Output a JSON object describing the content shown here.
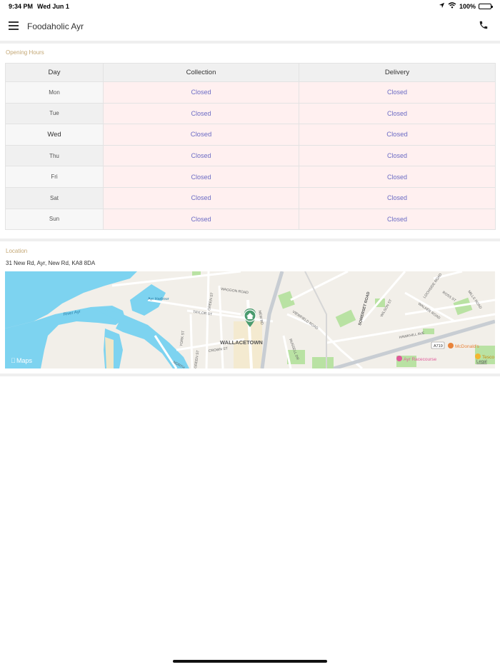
{
  "status_bar": {
    "time": "9:34 PM",
    "date": "Wed Jun 1",
    "battery": "100%",
    "battery_level": 1.0
  },
  "header": {
    "title": "Foodaholic Ayr"
  },
  "opening_hours": {
    "label": "Opening Hours",
    "columns": [
      "Day",
      "Collection",
      "Delivery"
    ],
    "rows": [
      {
        "day": "Mon",
        "collection": "Closed",
        "delivery": "Closed"
      },
      {
        "day": "Tue",
        "collection": "Closed",
        "delivery": "Closed"
      },
      {
        "day": "Wed",
        "collection": "Closed",
        "delivery": "Closed"
      },
      {
        "day": "Thu",
        "collection": "Closed",
        "delivery": "Closed"
      },
      {
        "day": "Fri",
        "collection": "Closed",
        "delivery": "Closed"
      },
      {
        "day": "Sat",
        "collection": "Closed",
        "delivery": "Closed"
      },
      {
        "day": "Sun",
        "collection": "Closed",
        "delivery": "Closed"
      }
    ]
  },
  "location": {
    "label": "Location",
    "address": "31 New Rd, Ayr, New Rd, KA8 8DA",
    "map": {
      "attribution": "Maps",
      "legal": "Legal",
      "labels": {
        "harbour": "Ayr Harbour",
        "river": "River Ayr",
        "waggon_road": "WAGGON ROAD",
        "taylor_st": "TAYLOR ST",
        "green_st": "GREEN ST",
        "viewfield_road": "VIEWFIELD ROAD",
        "new_rd": "NEW RD",
        "wallacetown": "WALLACETOWN",
        "york_st": "YORK ST",
        "crown_st": "CROWN ST",
        "craigie_st": "GREEN ST",
        "north_st": "NORTH",
        "somerset_road": "SOMERSET ROAD",
        "wilson_st": "WILSON ST",
        "walker_road": "WALKER ROAD",
        "ross_st": "ROSS ST",
        "lochside_road": "LOCHSIDE ROAD",
        "mills_road": "MILLS ROAD",
        "hawkhill_ave": "HAWKHILL AVE",
        "a719": "A719",
        "mcdonalds": "McDonald's",
        "racecourse": "Ayr Racecourse",
        "tesco": "Tesco",
        "russell_dr": "RUSSELL DR"
      },
      "colors": {
        "water": "#7dd3f0",
        "land": "#f2efe9",
        "park": "#b9e2a3",
        "pin": "#4a9b6e",
        "poi_orange": "#e8833a",
        "poi_pink": "#e05a9a"
      }
    }
  }
}
